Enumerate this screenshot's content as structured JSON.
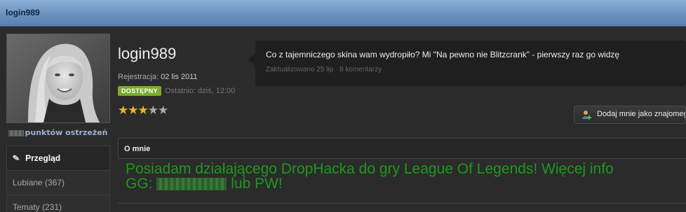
{
  "header": {
    "title": "login989"
  },
  "profile": {
    "username": "login989",
    "registration_label": "Rejestracja:",
    "registration_date": "02 lis 2011",
    "status_badge": "DOSTĘPNY",
    "last_seen": "Ostatnio: dziś, 12:00",
    "rating": 3,
    "rating_max": 5,
    "warnings_label": "punktów ostrzeżeń"
  },
  "status_update": {
    "text": "Co z tajemniczego skina wam wydropiło? Mi \"Na pewno nie Blitzcrank\" - pierwszy raz go widzę",
    "meta": "Zaktualizowano 25 lip · 8 komentarzy"
  },
  "actions": {
    "add_friend": "Dodaj mnie jako znajomego"
  },
  "nav": [
    {
      "label": "Przegląd"
    },
    {
      "label": "Lubiane (367)"
    },
    {
      "label": "Tematy (231)"
    }
  ],
  "about": {
    "heading": "O mnie",
    "line1": "Posiadam działającego DropHacka do gry League Of Legends! Więcej info",
    "line2_prefix": "GG:",
    "line2_suffix": "lub PW!"
  },
  "colors": {
    "header": "#7aa0cc",
    "badge": "#7aab2a",
    "about_text": "#1c9a1c",
    "star": "#e3b830"
  }
}
